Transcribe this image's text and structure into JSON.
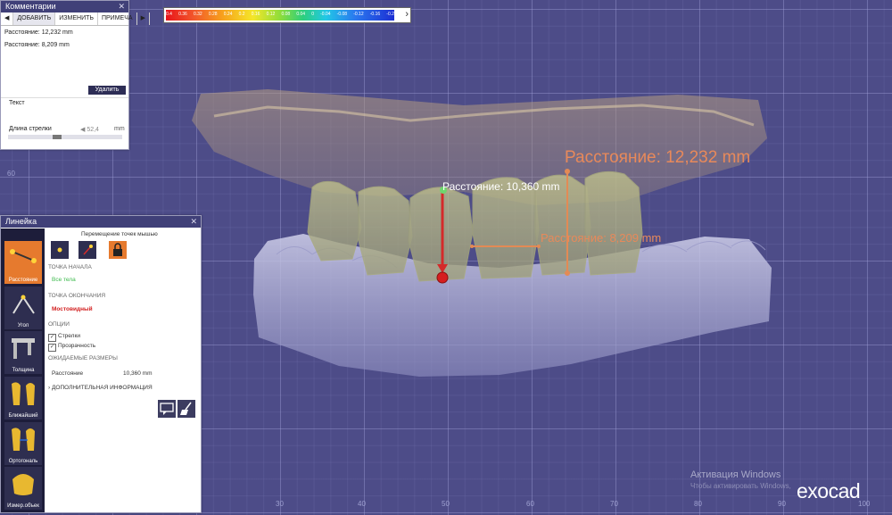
{
  "comments_panel": {
    "title": "Комментарии",
    "tabs": [
      "ДОБАВИТЬ",
      "ИЗМЕНИТЬ",
      "ПРИМЕЧА"
    ],
    "entries": [
      "Расстояние: 12,232 mm",
      "Расстояние: 8,209 mm"
    ],
    "delete_label": "Удалить",
    "text_label": "Текст",
    "arrow_length_label": "Длина стрелки",
    "arrow_length_value": "52,4",
    "arrow_length_unit": "mm"
  },
  "ruler_panel": {
    "title": "Линейка",
    "hint": "Перемещение точек мышью",
    "tools": [
      "Расстояние",
      "Угол",
      "Толщина",
      "Ближайший",
      "Ортогональ",
      "Измер.объек"
    ],
    "start_point_label": "ТОЧКА НАЧАЛА",
    "start_point_value": "Все тела",
    "end_point_label": "ТОЧКА ОКОНЧАНИЯ",
    "end_point_value": "Мостовидный",
    "options_label": "ОПЦИИ",
    "option_arrows": "Стрелки",
    "option_transparency": "Прозрачность",
    "expected_label": "ОЖИДАЕМЫЕ РАЗМЕРЫ",
    "distance_label": "Расстояние",
    "distance_value": "10,360 mm",
    "more_info": "ДОПОЛНИТЕЛЬНАЯ ИНФОРМАЦИЯ"
  },
  "measurements": {
    "m1": "Расстояние: 12,232 mm",
    "m2": "Расстояние: 10,360 mm",
    "m3": "Расстояние: 8,209 mm"
  },
  "colors": {
    "measure_orange": "#e38a55",
    "measure_red": "#d42a2a",
    "accent_orange": "#e67a2e",
    "background": "#4d4c88"
  },
  "scale_ticks": [
    "0.4",
    "0.36",
    "0.32",
    "0.28",
    "0.24",
    "0.2",
    "0.16",
    "0.12",
    "0.08",
    "0.04",
    "0",
    "-0.04",
    "-0.08",
    "-0.12",
    "-0.16",
    "-0.2"
  ],
  "ruler_labels": [
    "30",
    "40",
    "50",
    "60",
    "70",
    "80",
    "90",
    "100",
    "60"
  ],
  "watermark": {
    "line1": "Активация Windows",
    "line2": "Чтобы активировать Windows,"
  },
  "logo": "exocad"
}
